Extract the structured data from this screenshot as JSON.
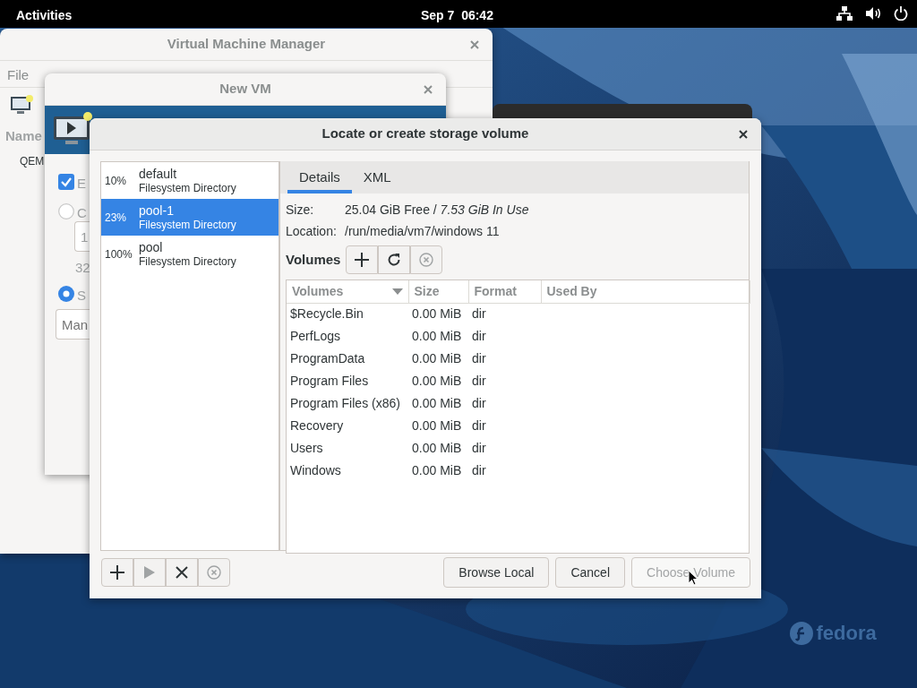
{
  "top_bar": {
    "activities": "Activities",
    "clock": "Sep 7  06:42"
  },
  "vmm_window": {
    "title": "Virtual Machine Manager",
    "menu": [
      "File"
    ],
    "column_header": "Name",
    "rows": [
      "QEM"
    ]
  },
  "new_vm_window": {
    "title": "New VM",
    "options": [
      {
        "kind": "checkbox",
        "label": "E",
        "checked": true
      },
      {
        "kind": "radio",
        "label": "C",
        "selected": false
      },
      {
        "kind": "field",
        "value": "1"
      },
      {
        "kind": "text",
        "label": "32"
      },
      {
        "kind": "radio",
        "label": "S",
        "selected": true
      },
      {
        "kind": "field",
        "placeholder": "Man"
      }
    ]
  },
  "dialog": {
    "title": "Locate or create storage volume",
    "pools": [
      {
        "usage": "10%",
        "name": "default",
        "type": "Filesystem Directory",
        "selected": false
      },
      {
        "usage": "23%",
        "name": "pool-1",
        "type": "Filesystem Directory",
        "selected": true
      },
      {
        "usage": "100%",
        "name": "pool",
        "type": "Filesystem Directory",
        "selected": false
      }
    ],
    "pool_buttons": [
      {
        "kind": "add",
        "disabled": false
      },
      {
        "kind": "start",
        "disabled": true
      },
      {
        "kind": "stop",
        "disabled": false
      },
      {
        "kind": "delete",
        "disabled": true
      }
    ],
    "tabs": [
      {
        "label": "Details",
        "selected": true
      },
      {
        "label": "XML",
        "selected": false
      }
    ],
    "size_label": "Size:",
    "size_value": "25.04 GiB Free / *7.53 GiB In Use*",
    "location_label": "Location:",
    "location": "/run/media/vm7/windows 11",
    "volumes_label": "Volumes",
    "volume_buttons": [
      {
        "kind": "add",
        "disabled": false
      },
      {
        "kind": "refresh",
        "disabled": false
      },
      {
        "kind": "delete",
        "disabled": true
      }
    ],
    "table": {
      "columns": [
        "Volumes",
        "Size",
        "Format",
        "Used By"
      ],
      "rows": [
        {
          "name": "$Recycle.Bin",
          "size": "0.00 MiB",
          "format": "dir"
        },
        {
          "name": "PerfLogs",
          "size": "0.00 MiB",
          "format": "dir"
        },
        {
          "name": "ProgramData",
          "size": "0.00 MiB",
          "format": "dir"
        },
        {
          "name": "Program Files",
          "size": "0.00 MiB",
          "format": "dir"
        },
        {
          "name": "Program Files (x86)",
          "size": "0.00 MiB",
          "format": "dir"
        },
        {
          "name": "Recovery",
          "size": "0.00 MiB",
          "format": "dir"
        },
        {
          "name": "Users",
          "size": "0.00 MiB",
          "format": "dir"
        },
        {
          "name": "Windows",
          "size": "0.00 MiB",
          "format": "dir"
        }
      ]
    },
    "buttons": [
      {
        "label": "Browse Local",
        "disabled": false
      },
      {
        "label": "Cancel",
        "disabled": false
      },
      {
        "label": "Choose Volume",
        "disabled": true
      }
    ]
  },
  "wallpaper_logo": "fedora"
}
